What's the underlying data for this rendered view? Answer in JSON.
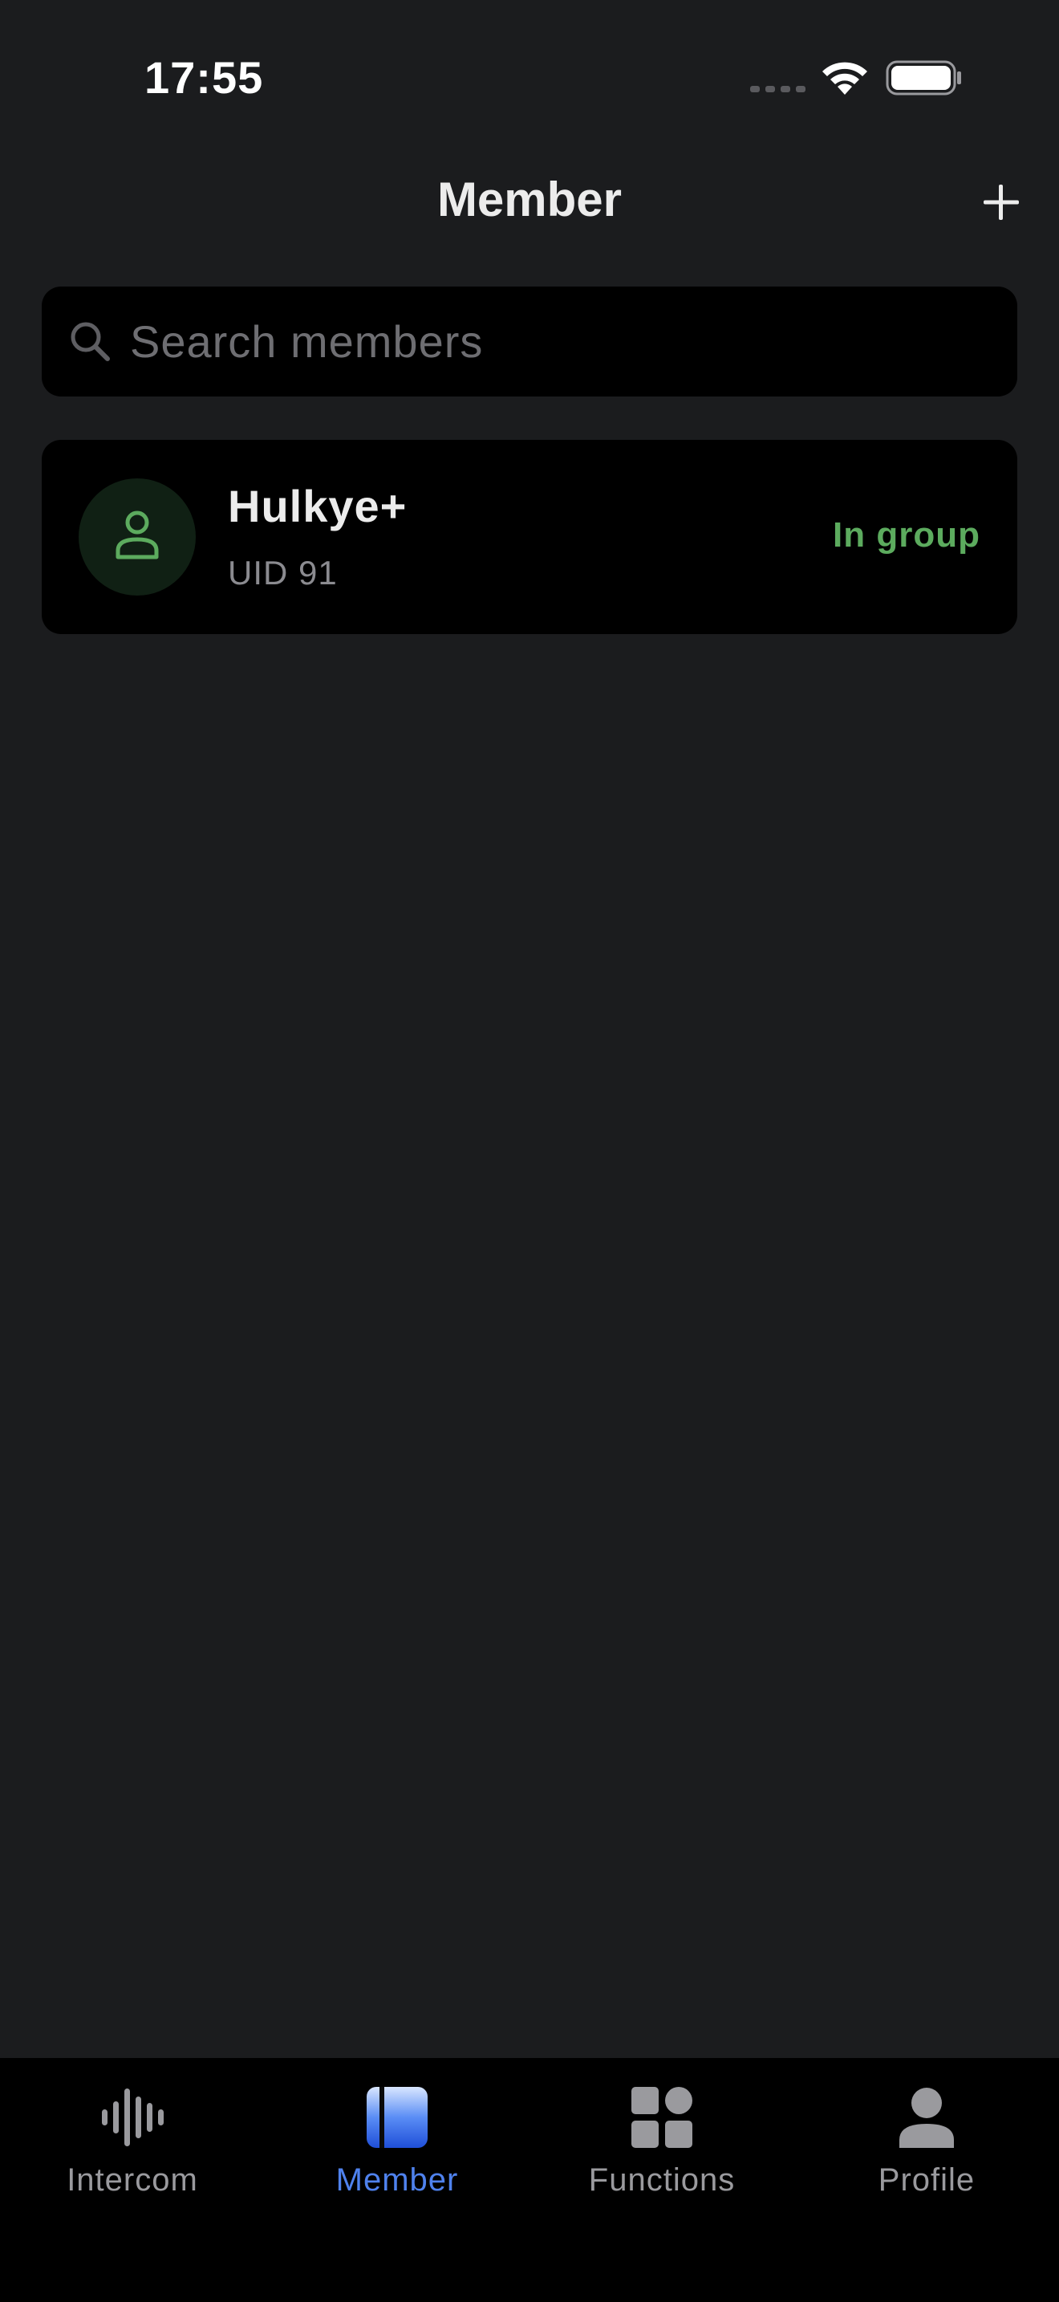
{
  "status_bar": {
    "time": "17:55"
  },
  "header": {
    "title": "Member",
    "add_icon": "plus-icon"
  },
  "search": {
    "placeholder": "Search members",
    "value": "",
    "icon": "search-icon"
  },
  "members": [
    {
      "name": "Hulkye+",
      "uid": "UID 91",
      "status": "In group",
      "status_color": "#5cab5e",
      "avatar_icon": "person-icon"
    }
  ],
  "tab_bar": {
    "active": "Member",
    "active_color": "#4f82ee",
    "tabs": [
      {
        "label": "Intercom",
        "icon": "waveform-icon"
      },
      {
        "label": "Member",
        "icon": "member-book-icon"
      },
      {
        "label": "Functions",
        "icon": "grid-icon"
      },
      {
        "label": "Profile",
        "icon": "person-icon"
      }
    ]
  },
  "colors": {
    "background": "#1b1c1e",
    "card": "#000000",
    "accent": "#4f82ee",
    "success": "#5cab5e"
  }
}
